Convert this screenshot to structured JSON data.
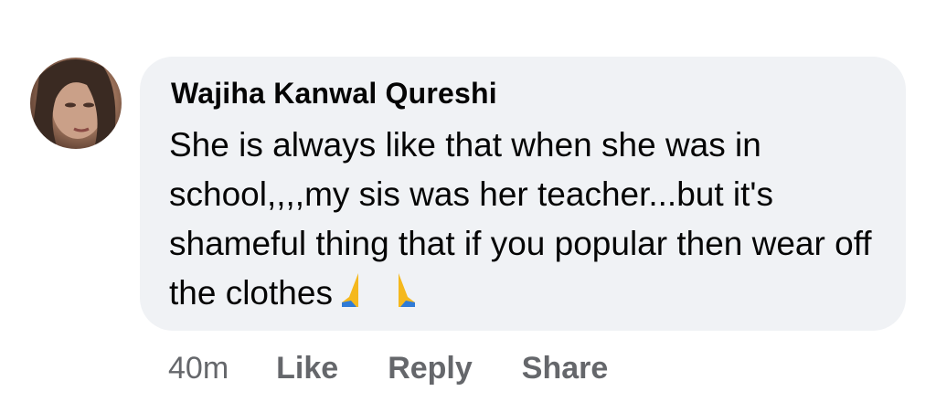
{
  "comment": {
    "author": "Wajiha Kanwal Qureshi",
    "text": "She is always like that when she was in school,,,,my sis was her teacher...but it's shameful thing that if you popular then wear off the clothes",
    "emoji": [
      "folded-hands-icon",
      "folded-hands-icon"
    ],
    "avatar": "user-avatar-photo"
  },
  "footer": {
    "timestamp": "40m",
    "like_label": "Like",
    "reply_label": "Reply",
    "share_label": "Share"
  },
  "colors": {
    "bubble": "#f0f2f5",
    "text": "#050505",
    "secondary": "#65676b"
  }
}
